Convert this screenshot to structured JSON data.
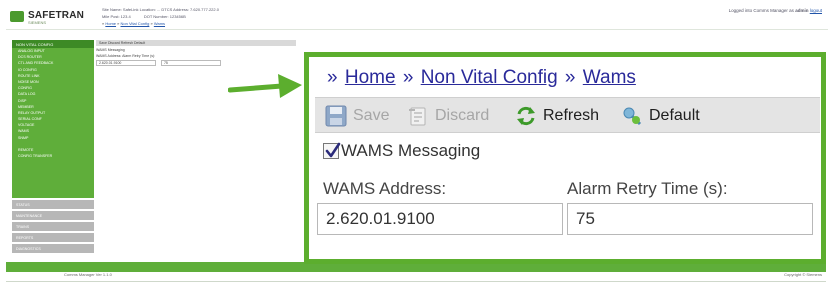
{
  "app": {
    "logo_text": "SAFETRAN",
    "logo_sub": "SIEMENS",
    "site_line1": "Site Name: SafeLink   Location: ...   DTCS Address: 7.620.777.222.0",
    "site_line2_a": "Mile Post: 123.4",
    "site_line2_b": "DOT Number: 123456B",
    "logged_in_prefix": "Logged into Comms Manager as",
    "logged_in_user": "admin",
    "logout_label": "logout"
  },
  "mini_breadcrumb": {
    "prefix": "»",
    "home": "Home",
    "section": "Non Vital Config",
    "page": "Wams"
  },
  "sidebar": {
    "header": "NON VITAL CONFIG",
    "items": [
      "ANALOG INPUT",
      "DCS ROUTER",
      "CTL AND FEEDBACK",
      "IO CONFIG",
      "ROUTE LINK",
      "NOISE MON",
      "CONFIG",
      "DATA LOG",
      "DISP",
      "MEMBER",
      "RELAY OUTPUT",
      "SERIAL CONF",
      "VOLTAGE",
      "WAMS",
      "SNMP"
    ],
    "extra_items": [
      "REMOTE",
      "CONFIG TRANSFER"
    ],
    "grey_items": [
      "STATUS",
      "MAINTENANCE",
      "TRAINS",
      "REPORTS",
      "DIAGNOSTICS"
    ]
  },
  "mini_main": {
    "toolbar": "Save   Discard   Refresh   Default",
    "check": "WAMS Messaging",
    "label_line": "WAMS Address:          Alarm Retry Time (s):",
    "address": "2.620.01.9100",
    "retry": "75"
  },
  "footer": {
    "left": "Comms Manager Ver 1.1.0",
    "right": "Copyright © Siemens"
  },
  "breadcrumb": {
    "sep": "»",
    "home": "Home",
    "section": "Non Vital Config",
    "page": "Wams"
  },
  "toolbar": {
    "save_label": "Save",
    "discard_label": "Discard",
    "refresh_label": "Refresh",
    "default_label": "Default"
  },
  "wams": {
    "messaging_label": "WAMS Messaging",
    "messaging_checked": true,
    "address_label": "WAMS Address:",
    "address_value": "2.620.01.9100",
    "retry_label": "Alarm Retry Time (s):",
    "retry_value": "75"
  },
  "colors": {
    "accent_green": "#5cae2e",
    "link_blue": "#2a2a9a",
    "sidebar_green": "#5fae3a"
  },
  "icons": {
    "save": "floppy-disk-icon",
    "discard": "discard-icon",
    "refresh": "refresh-arrows-icon",
    "default": "default-wrench-icon"
  }
}
